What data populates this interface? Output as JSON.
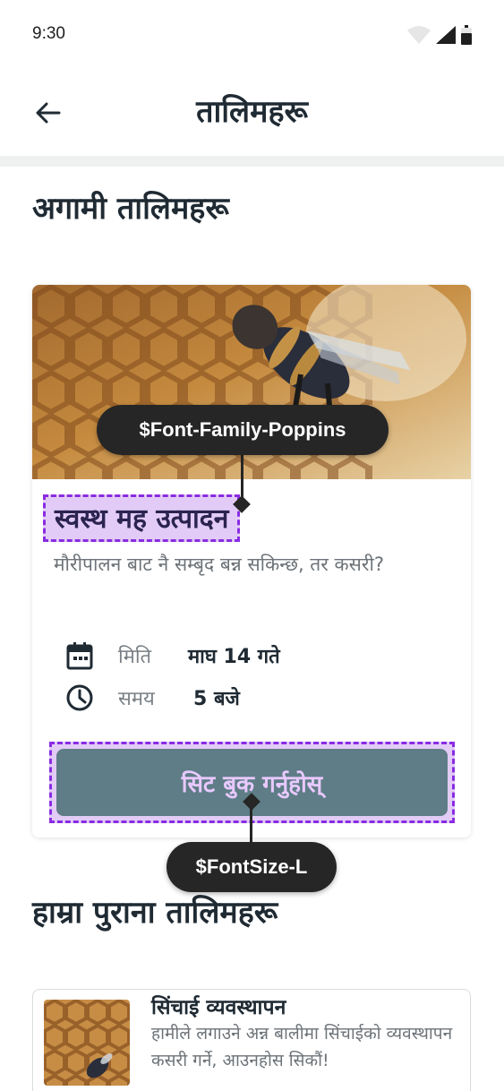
{
  "status_bar": {
    "time": "9:30",
    "icons": [
      "wifi-icon",
      "signal-icon",
      "battery-icon"
    ]
  },
  "app_bar": {
    "title": "तालिमहरू",
    "back_icon": "arrow-left-icon"
  },
  "upcoming": {
    "section_title": "अगामी तालिमहरू",
    "card": {
      "image": "honeycomb-bee-photo",
      "title": "स्वस्थ मह उत्पादन",
      "description": "मौरीपालन बाट नै सम्बृद बन्न सकिन्छ, तर कसरी?",
      "date_label": "मिति",
      "date_value": "माघ 14 गते",
      "time_label": "समय",
      "time_value": "5 बजे",
      "book_button": "सिट बुक गर्नुहोस्"
    }
  },
  "annotations": {
    "font_family": "$Font-Family-Poppins",
    "font_size": "$FontSize-L"
  },
  "past": {
    "section_title": "हाम्रा पुराना तालिमहरू",
    "items": [
      {
        "title": "सिंचाई व्यवस्थापन",
        "description": "हामीले लगाउने अन्न बालीमा सिंचाईको व्यवस्थापन कसरी गर्ने, आउनहोस सिकौं!"
      }
    ]
  },
  "colors": {
    "button": "#5f7d86",
    "highlight": "#e2ccf7",
    "highlight_border": "#8a2be2",
    "annotation": "#262626"
  }
}
